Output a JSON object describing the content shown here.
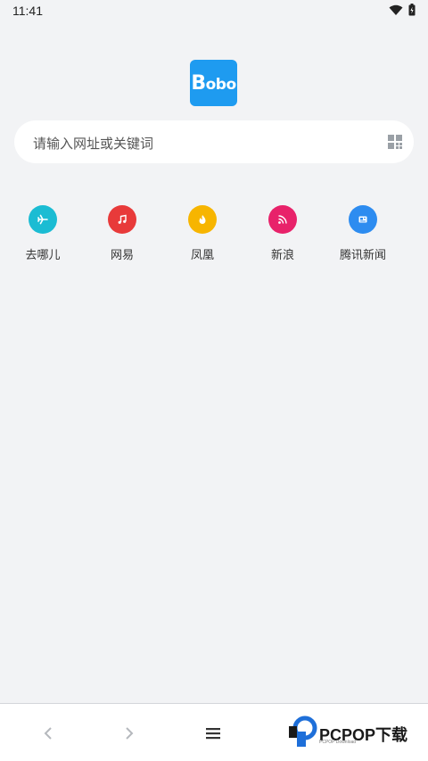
{
  "status_bar": {
    "time": "11:41",
    "icons": [
      "wifi-icon",
      "battery-icon"
    ]
  },
  "logo": {
    "text_big": "B",
    "text_rest": "obo",
    "color": "#1e9bf0"
  },
  "search": {
    "placeholder": "请输入网址或关键词",
    "icon": "qr-code-icon"
  },
  "shortcuts": [
    {
      "label": "去哪儿",
      "icon": "airplane-icon",
      "color": "#1bbcd3"
    },
    {
      "label": "网易",
      "icon": "music-note-icon",
      "color": "#e83a3a"
    },
    {
      "label": "凤凰",
      "icon": "flame-icon",
      "color": "#f7b500"
    },
    {
      "label": "新浪",
      "icon": "rss-icon",
      "color": "#e8226a"
    },
    {
      "label": "腾讯新闻",
      "icon": "news-icon",
      "color": "#2d8cf0"
    }
  ],
  "bottom_nav": {
    "icons": [
      "back-icon",
      "forward-icon",
      "menu-icon"
    ]
  },
  "watermark": {
    "text": "PCPOP下载",
    "sub": "PCPOP Download"
  }
}
